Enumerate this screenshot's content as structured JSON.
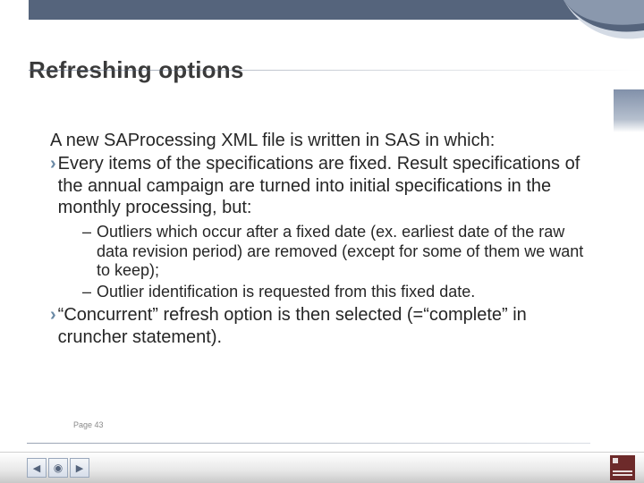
{
  "title": "Refreshing options",
  "intro": "A new SAProcessing XML file is written in SAS in which:",
  "bullets": [
    {
      "text": "Every items of the specifications are fixed. Result specifications of the annual campaign are turned into initial specifications in the monthly processing, but:",
      "sub": [
        "Outliers which occur after a fixed date (ex. earliest date of the raw data revision period) are removed (except for some of them we want to keep);",
        "Outlier identification is requested from this fixed date."
      ]
    },
    {
      "text": "“Concurrent” refresh option is then selected (=“complete” in cruncher statement).",
      "sub": []
    }
  ],
  "page_label": "Page 43",
  "nav": {
    "prev_glyph": "◀",
    "home_glyph": "◉",
    "next_glyph": "▶"
  },
  "colors": {
    "header": "#55647c",
    "bullet_marker": "#6a89a5"
  }
}
